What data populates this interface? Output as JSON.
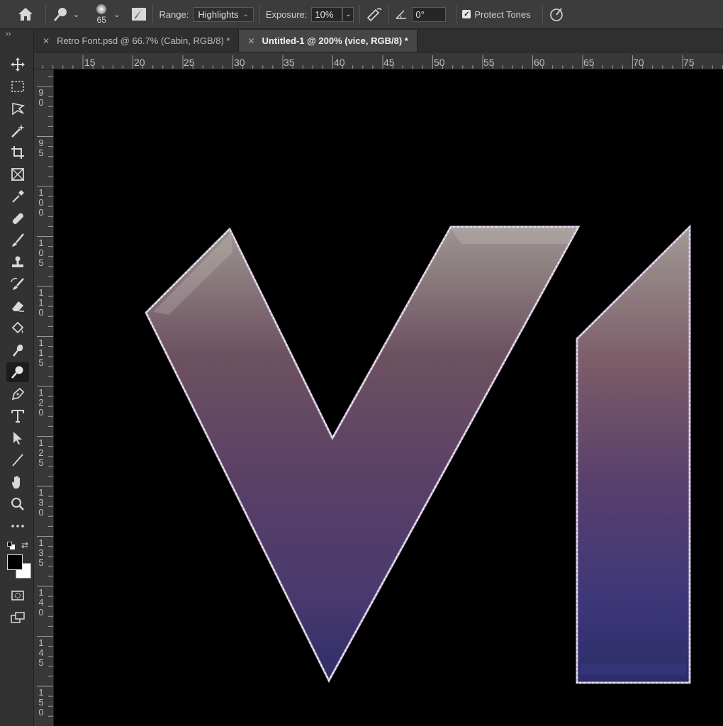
{
  "options_bar": {
    "home_icon": "home-icon",
    "tool_icon": "dodge-tool-icon",
    "brush_size": "65",
    "range_label": "Range:",
    "range_value": "Highlights",
    "exposure_label": "Exposure:",
    "exposure_value": "10%",
    "angle_value": "0°",
    "protect_tones_label": "Protect Tones",
    "protect_tones_checked": true
  },
  "tabs": [
    {
      "label": "Retro Font.psd @ 66.7% (Cabin, RGB/8) *",
      "active": false
    },
    {
      "label": "Untitled-1 @ 200% (vice, RGB/8) *",
      "active": true
    }
  ],
  "toolbar": {
    "collapse_glyph": "››",
    "tools": [
      "move",
      "marquee",
      "lasso",
      "magic-wand",
      "crop",
      "frame",
      "eyedropper",
      "healing",
      "brush",
      "clone-stamp",
      "history-brush",
      "eraser",
      "paint-bucket",
      "blur",
      "dodge",
      "pen",
      "type",
      "path-select",
      "line",
      "hand",
      "zoom",
      "more"
    ],
    "selected_tool": "dodge",
    "foreground_color": "#000000",
    "background_color": "#ffffff"
  },
  "rulers": {
    "top": [
      "15",
      "20",
      "25",
      "30",
      "35",
      "40",
      "45",
      "50",
      "55",
      "60",
      "65",
      "70",
      "75"
    ],
    "left": [
      "90",
      "95",
      "100",
      "105",
      "110",
      "115",
      "120",
      "125",
      "130",
      "135",
      "140",
      "145",
      "150"
    ]
  },
  "colors": {
    "accent": "#6b4f86",
    "letter_top": "#9c9590",
    "letter_mid": "#5b4066",
    "letter_bottom": "#2f2e6a"
  }
}
